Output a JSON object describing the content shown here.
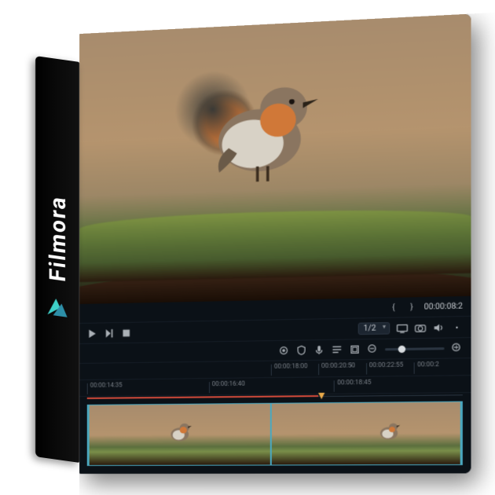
{
  "product": {
    "name": "Filmora",
    "logo_color_a": "#3ed0c8",
    "logo_color_b": "#2d8fa8"
  },
  "preview": {
    "timecode_label": "00:00:08:2",
    "marker_prev": "{",
    "marker_next": "}"
  },
  "transport": {
    "play_icon": "play",
    "step_icon": "step-forward",
    "stop_icon": "stop",
    "quality_label": "1/2"
  },
  "toolbar": {
    "record_icon": "record",
    "shield_icon": "shield",
    "mic_icon": "mic",
    "list_icon": "list",
    "crop_icon": "crop",
    "zoom_out_icon": "zoom-out",
    "zoom_in_icon": "zoom-in"
  },
  "ruler": {
    "ticks_top": [
      "00:00:18:00",
      "00:00:20:50",
      "00:00:22:55",
      "00:00:2"
    ],
    "ticks_main": [
      "00:00:14:35",
      "00:00:16:40",
      "00:00:18:45"
    ]
  },
  "icons": {
    "display": "display",
    "camera": "camera",
    "speaker": "speaker"
  }
}
